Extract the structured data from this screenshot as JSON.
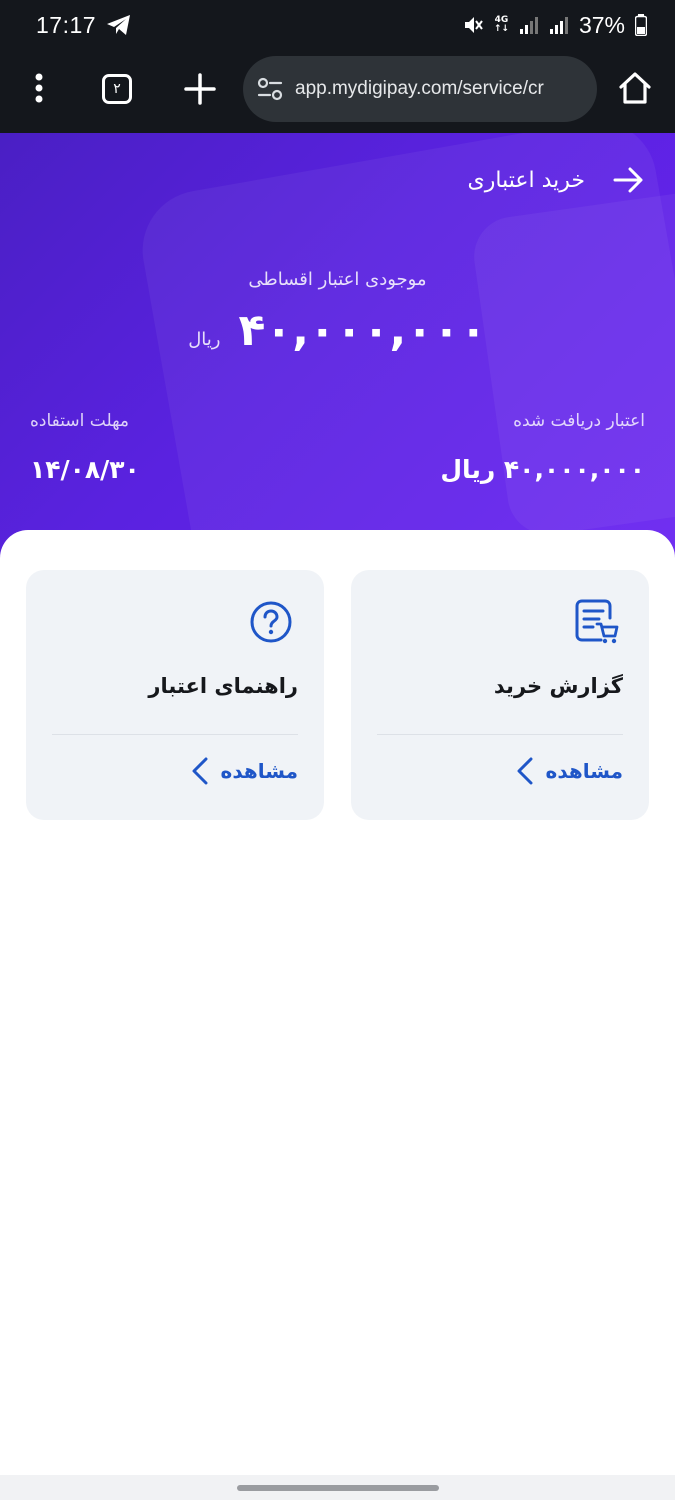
{
  "status_bar": {
    "time": "17:17",
    "network": "4G",
    "battery": "37%"
  },
  "browser": {
    "tab_count": "۲",
    "url": "app.mydigipay.com/service/cr"
  },
  "header": {
    "title": "خرید اعتباری"
  },
  "balance": {
    "label": "موجودی اعتبار اقساطی",
    "amount": "۴۰,۰۰۰,۰۰۰",
    "unit": "ریال"
  },
  "received": {
    "label": "اعتبار دریافت شده",
    "value": "۴۰,۰۰۰,۰۰۰ ریال"
  },
  "deadline": {
    "label": "مهلت استفاده",
    "value": "۱۴/۰۸/۳۰"
  },
  "cards": [
    {
      "title": "گزارش خرید",
      "link": "مشاهده",
      "icon": "receipt-cart-icon"
    },
    {
      "title": "راهنمای اعتبار",
      "link": "مشاهده",
      "icon": "question-circle-icon"
    }
  ],
  "colors": {
    "hero": "#5a22e0",
    "accent": "#1f56c8",
    "card_bg": "#f0f3f7"
  }
}
